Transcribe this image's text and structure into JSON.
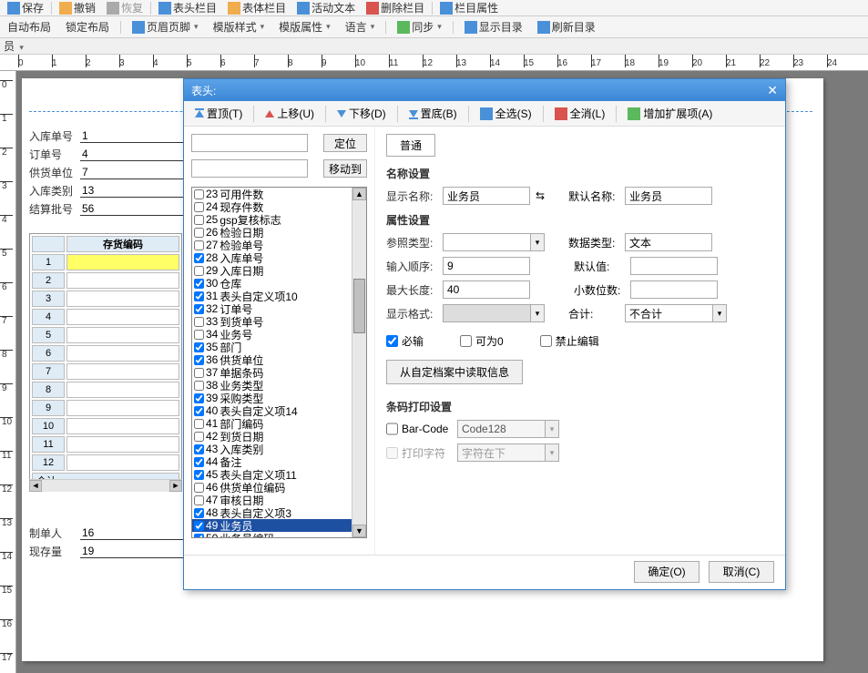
{
  "toolbar1": {
    "items": [
      "保存",
      "撤销",
      "恢复",
      "表头栏目",
      "表体栏目",
      "活动文本",
      "删除栏目",
      "栏目属性"
    ]
  },
  "toolbar2": {
    "items": [
      "自动布局",
      "锁定布局",
      "页眉页脚",
      "模版样式",
      "模版属性",
      "语言",
      "同步",
      "显示目录",
      "刷新目录"
    ]
  },
  "status": "员",
  "paper": {
    "form": {
      "rows": [
        {
          "label": "入库单号",
          "value": "1"
        },
        {
          "label": "订单号",
          "value": "4"
        },
        {
          "label": "供货单位",
          "value": "7"
        },
        {
          "label": "入库类别",
          "value": "13"
        },
        {
          "label": "结算批号",
          "value": "56"
        }
      ]
    },
    "table": {
      "header": "存货编码",
      "rows": [
        1,
        2,
        3,
        4,
        5,
        6,
        7,
        8,
        9,
        10,
        11,
        12
      ],
      "footer": "合计"
    },
    "form_bottom": [
      {
        "label": "制单人",
        "value": "16"
      },
      {
        "label": "现存量",
        "value": "19"
      }
    ]
  },
  "dialog": {
    "title": "表头:",
    "toolbar": [
      {
        "label": "置顶(T)"
      },
      {
        "label": "上移(U)"
      },
      {
        "label": "下移(D)"
      },
      {
        "label": "置底(B)"
      },
      {
        "label": "全选(S)"
      },
      {
        "label": "全消(L)"
      },
      {
        "label": "增加扩展项(A)"
      }
    ],
    "left": {
      "btn_locate": "定位",
      "btn_move": "移动到",
      "items": [
        {
          "n": 23,
          "chk": false,
          "t": "可用件数"
        },
        {
          "n": 24,
          "chk": false,
          "t": "现存件数"
        },
        {
          "n": 25,
          "chk": false,
          "t": "gsp复核标志"
        },
        {
          "n": 26,
          "chk": false,
          "t": "检验日期"
        },
        {
          "n": 27,
          "chk": false,
          "t": "检验单号"
        },
        {
          "n": 28,
          "chk": true,
          "t": "入库单号"
        },
        {
          "n": 29,
          "chk": false,
          "t": "入库日期"
        },
        {
          "n": 30,
          "chk": true,
          "t": "仓库"
        },
        {
          "n": 31,
          "chk": true,
          "t": "表头自定义项10"
        },
        {
          "n": 32,
          "chk": true,
          "t": "订单号"
        },
        {
          "n": 33,
          "chk": false,
          "t": "到货单号"
        },
        {
          "n": 34,
          "chk": false,
          "t": "业务号"
        },
        {
          "n": 35,
          "chk": true,
          "t": "部门"
        },
        {
          "n": 36,
          "chk": true,
          "t": "供货单位"
        },
        {
          "n": 37,
          "chk": false,
          "t": "单据条码"
        },
        {
          "n": 38,
          "chk": false,
          "t": "业务类型"
        },
        {
          "n": 39,
          "chk": true,
          "t": "采购类型"
        },
        {
          "n": 40,
          "chk": true,
          "t": "表头自定义项14"
        },
        {
          "n": 41,
          "chk": false,
          "t": "部门编码"
        },
        {
          "n": 42,
          "chk": false,
          "t": "到货日期"
        },
        {
          "n": 43,
          "chk": true,
          "t": "入库类别"
        },
        {
          "n": 44,
          "chk": true,
          "t": "备注"
        },
        {
          "n": 45,
          "chk": true,
          "t": "表头自定义项11"
        },
        {
          "n": 46,
          "chk": false,
          "t": "供货单位编码"
        },
        {
          "n": 47,
          "chk": false,
          "t": "审核日期"
        },
        {
          "n": 48,
          "chk": true,
          "t": "表头自定义项3"
        },
        {
          "n": 49,
          "chk": true,
          "t": "业务员",
          "sel": true
        },
        {
          "n": 50,
          "chk": true,
          "t": "业务员编码"
        }
      ]
    },
    "right": {
      "tab": "普通",
      "section_name": "名称设置",
      "display_name_label": "显示名称:",
      "display_name": "业务员",
      "default_name_label": "默认名称:",
      "default_name": "业务员",
      "section_attr": "属性设置",
      "ref_type_label": "参照类型:",
      "ref_type": "",
      "data_type_label": "数据类型:",
      "data_type": "文本",
      "input_order_label": "输入顺序:",
      "input_order": "9",
      "default_val_label": "默认值:",
      "default_val": "",
      "max_len_label": "最大长度:",
      "max_len": "40",
      "decimals_label": "小数位数:",
      "decimals": "",
      "display_fmt_label": "显示格式:",
      "display_fmt": "",
      "sum_label": "合计:",
      "sum": "不合计",
      "chk_required": "必输",
      "chk_zero": "可为0",
      "chk_noedit": "禁止编辑",
      "btn_read": "从自定档案中读取信息",
      "section_barcode": "条码打印设置",
      "barcode_label": "Bar-Code",
      "barcode_type": "Code128",
      "print_char_label": "打印字符",
      "print_char": "字符在下",
      "btn_ok": "确定(O)",
      "btn_cancel": "取消(C)"
    }
  },
  "ruler_h": [
    0,
    1,
    2,
    3,
    4,
    5,
    6,
    7,
    8,
    9,
    10,
    11,
    12,
    13,
    14,
    15,
    16,
    17,
    18,
    19,
    20,
    21,
    22,
    23,
    24
  ],
  "ruler_v": [
    0,
    1,
    2,
    3,
    4,
    5,
    6,
    7,
    8,
    9,
    10,
    11,
    12,
    13,
    14,
    15,
    16,
    17
  ]
}
